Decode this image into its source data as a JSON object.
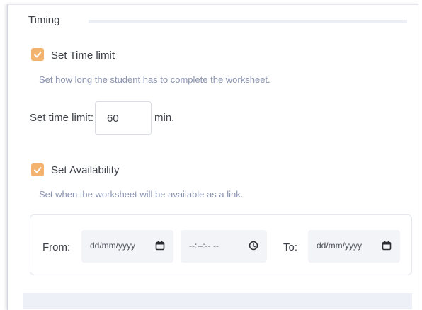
{
  "timing": {
    "section_title": "Timing"
  },
  "time_limit": {
    "checkbox_label": "Set Time limit",
    "checked": true,
    "help_text": "Set how long the student has to complete the worksheet.",
    "field_label": "Set time limit:",
    "value": "60",
    "unit": "min."
  },
  "availability": {
    "checkbox_label": "Set Availability",
    "checked": true,
    "help_text": "Set when the worksheet will be available as a link.",
    "from_label": "From:",
    "from_date_placeholder": "dd/mm/yyyy",
    "from_time_placeholder": "--:--:-- --",
    "to_label": "To:",
    "to_date_placeholder": "dd/mm/yyyy"
  },
  "colors": {
    "accent": "#f3b36f",
    "help_text": "#8a93b0",
    "field_bg": "#f2f4f7"
  },
  "icons": [
    "checkmark-icon",
    "calendar-icon",
    "clock-icon"
  ]
}
